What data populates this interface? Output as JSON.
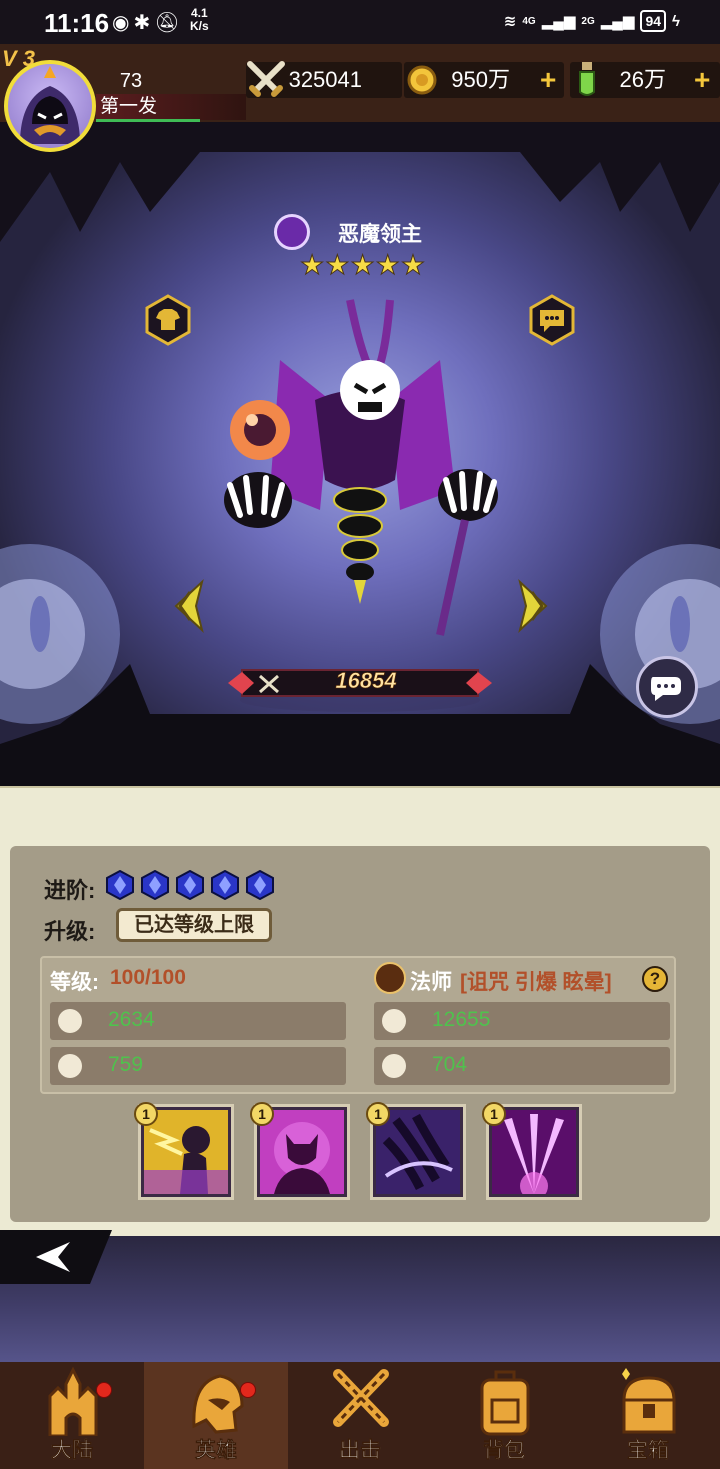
{
  "status_bar": {
    "time": "11:16",
    "speed_value": "4.1",
    "speed_unit": "K/s",
    "signal_4g": "4G",
    "signal_2g": "2G",
    "battery": "94"
  },
  "player": {
    "vip_label": "V 3",
    "level": "73",
    "name": "第一发"
  },
  "currencies": [
    {
      "icon": "crossed-swords-icon",
      "value": "325041"
    },
    {
      "icon": "gold-coin-icon",
      "value": "950万"
    },
    {
      "icon": "green-potion-icon",
      "value": "26万"
    }
  ],
  "plus_label": "+",
  "hero": {
    "name": "恶魔领主",
    "stars": 5,
    "power": "16854"
  },
  "panel": {
    "advance_label": "进阶:",
    "advance_gems": 5,
    "upgrade_label": "升级:",
    "max_level_button": "已达等级上限",
    "level_label": "等级:",
    "level_value": "100/100",
    "class_name": "法师",
    "class_tags": "[诅咒 引爆 眩晕]",
    "help_label": "?",
    "stats": {
      "attack": {
        "icon": "attack-icon",
        "value": "2634"
      },
      "hp": {
        "icon": "heart-icon",
        "value": "12655"
      },
      "defense": {
        "icon": "shield-icon",
        "value": "759"
      },
      "speed": {
        "icon": "boot-icon",
        "value": "704"
      }
    },
    "skills": [
      {
        "level": "1"
      },
      {
        "level": "1"
      },
      {
        "level": "1"
      },
      {
        "level": "1"
      }
    ]
  },
  "colors": {
    "accent_gold": "#f4c73c",
    "stat_green": "#4fc24d",
    "tag_orange": "#b2502a",
    "badge_red": "#e2281c"
  },
  "nav": [
    {
      "label": "大陆",
      "icon": "castle-icon",
      "badge": true
    },
    {
      "label": "英雄",
      "icon": "helmet-icon",
      "badge": true
    },
    {
      "label": "出击",
      "icon": "crossed-swords-icon",
      "badge": false
    },
    {
      "label": "背包",
      "icon": "backpack-icon",
      "badge": false
    },
    {
      "label": "宝箱",
      "icon": "treasure-chest-icon",
      "badge": false
    }
  ]
}
